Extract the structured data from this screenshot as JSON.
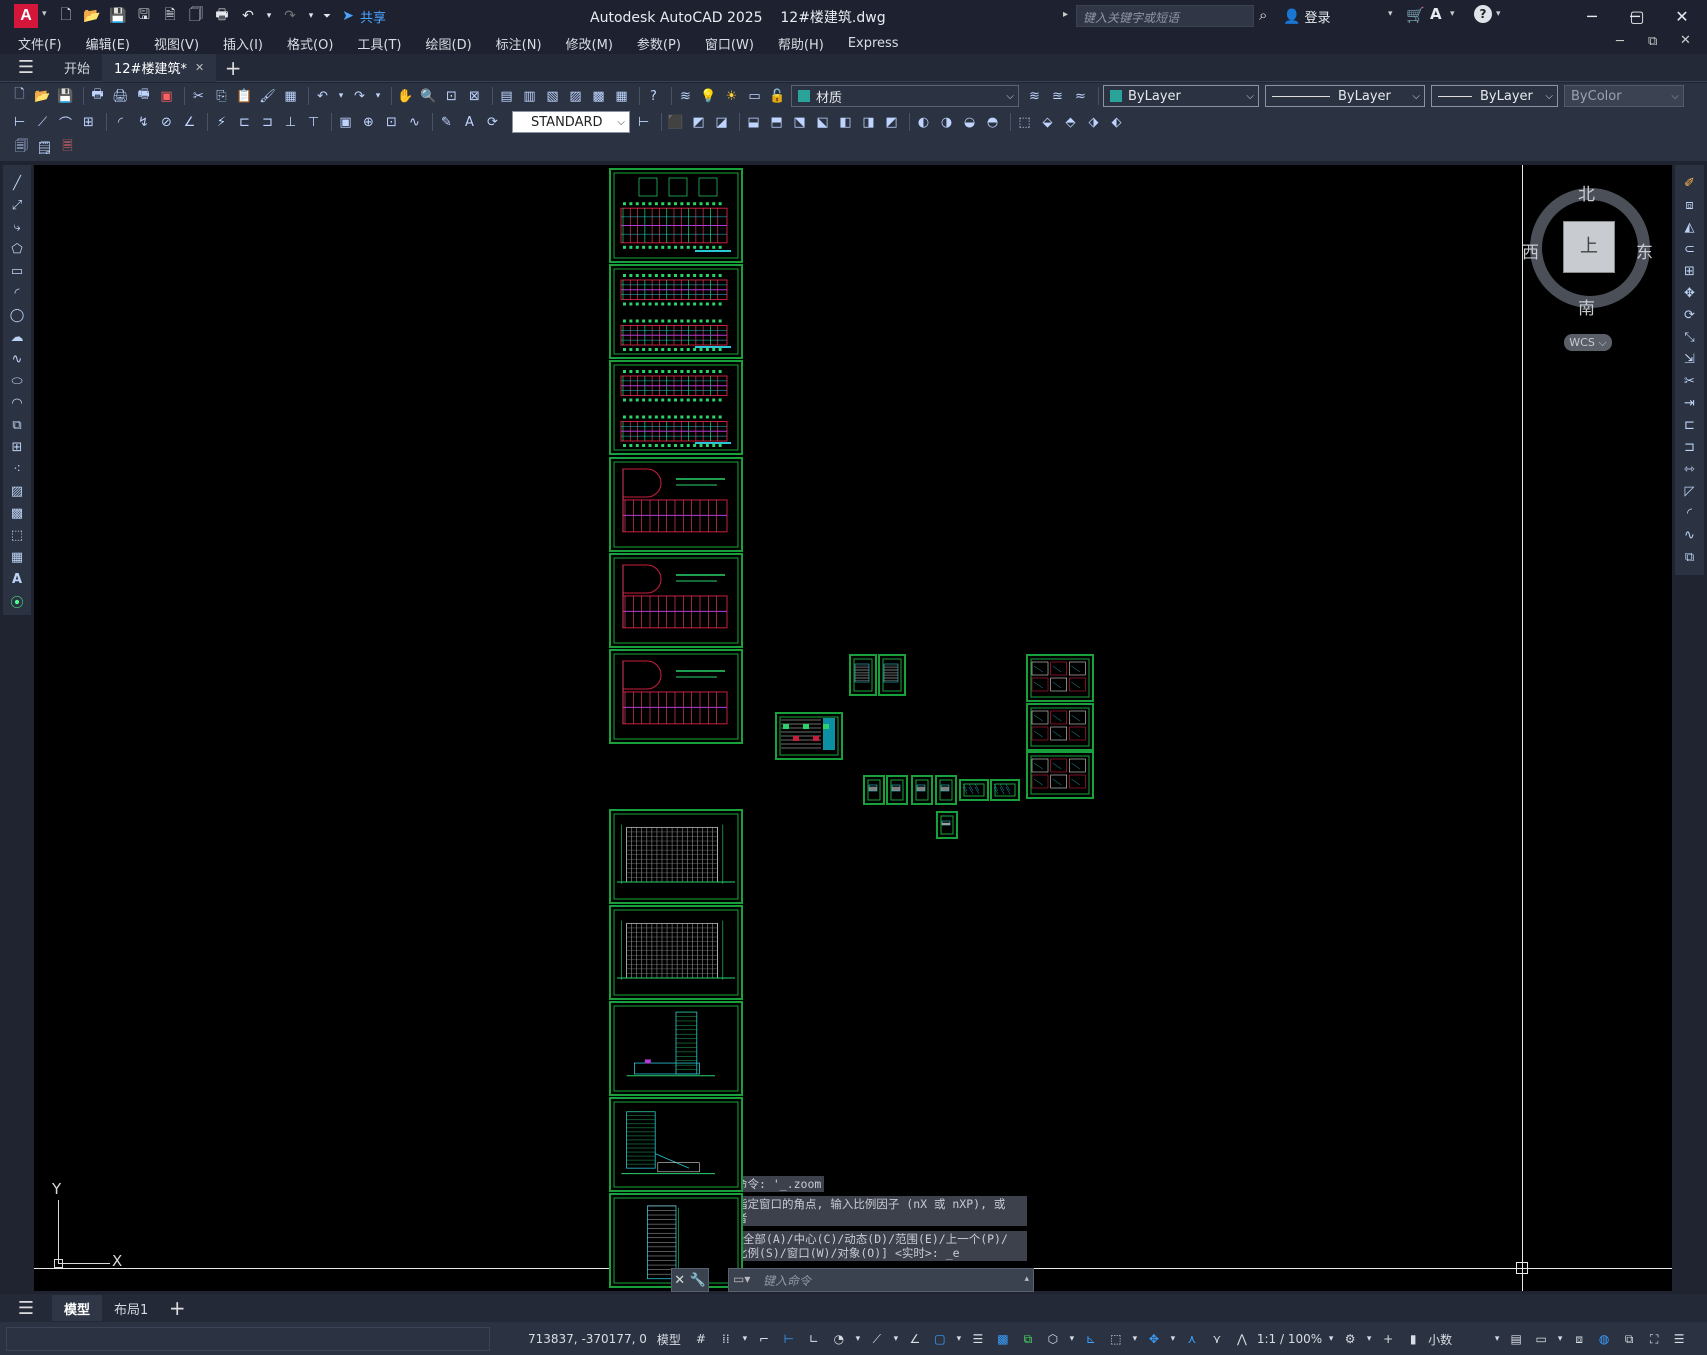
{
  "app": {
    "logo_letter": "A",
    "title": "Autodesk AutoCAD 2025",
    "filename": "12#楼建筑.dwg",
    "share_label": "共享",
    "search_placeholder": "键入关键字或短语",
    "login_label": "登录"
  },
  "menu": [
    "文件(F)",
    "编辑(E)",
    "视图(V)",
    "插入(I)",
    "格式(O)",
    "工具(T)",
    "绘图(D)",
    "标注(N)",
    "修改(M)",
    "参数(P)",
    "窗口(W)",
    "帮助(H)",
    "Express"
  ],
  "file_tabs": {
    "start": "开始",
    "current": "12#楼建筑*"
  },
  "toolbar": {
    "text_style": "STANDARD",
    "layer": "材质",
    "color": "ByLayer",
    "linetype": "ByLayer",
    "lineweight": "ByLayer",
    "plotstyle": "ByColor"
  },
  "viewcube": {
    "north": "北",
    "south": "南",
    "east": "东",
    "west": "西",
    "face": "上",
    "wcs": "WCS"
  },
  "ucs": {
    "x": "X",
    "y": "Y"
  },
  "command": {
    "history": [
      "命令: '_.zoom",
      "指定窗口的角点, 输入比例因子 (nX 或 nXP), 或",
      "者",
      "[全部(A)/中心(C)/动态(D)/范围(E)/上一个(P)/",
      "比例(S)/窗口(W)/对象(O)] <实时>: _e"
    ],
    "placeholder": "键入命令"
  },
  "layout_tabs": {
    "model": "模型",
    "layout1": "布局1"
  },
  "status": {
    "coords": "713837, -370177, 0",
    "space": "模型",
    "scale": "1:1 / 100%",
    "units": "小数"
  },
  "colors": {
    "sheet_border": "#18a13a",
    "accent_red": "#d3163a",
    "canvas": "#000000"
  }
}
